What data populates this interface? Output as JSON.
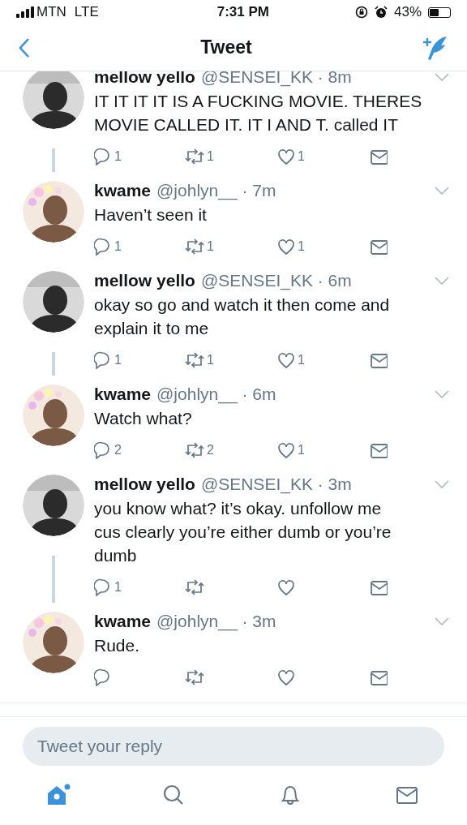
{
  "status_bar": {
    "carrier": "MTN",
    "network": "LTE",
    "time": "7:31 PM",
    "battery": "43%"
  },
  "nav": {
    "title": "Tweet"
  },
  "tweets": [
    {
      "name": "mellow yello",
      "meta": "@SENSEI_KK · 8m",
      "text": "IT IT IT IT IS A FUCKING MOVIE. THERES MOVIE CALLED IT. IT I AND T. called IT",
      "replies": "1",
      "retweets": "1",
      "likes": "1"
    },
    {
      "name": "kwame",
      "meta": "@johlyn__ · 7m",
      "text": "Haven’t seen it",
      "replies": "1",
      "retweets": "1",
      "likes": "1"
    },
    {
      "name": "mellow yello",
      "meta": "@SENSEI_KK · 6m",
      "text": "okay so go and watch it then come and explain it to me",
      "replies": "1",
      "retweets": "1",
      "likes": "1"
    },
    {
      "name": "kwame",
      "meta": "@johlyn__ · 6m",
      "text": "Watch what?",
      "replies": "2",
      "retweets": "2",
      "likes": "1"
    },
    {
      "name": "mellow yello",
      "meta": "@SENSEI_KK · 3m",
      "text": "you know what? it’s okay. unfollow me\ncus clearly you’re either dumb or you’re dumb",
      "replies": "1"
    },
    {
      "name": "kwame",
      "meta": "@johlyn__ · 3m",
      "text": "Rude."
    }
  ],
  "reply_field": {
    "placeholder": "Tweet your reply"
  },
  "tab_bar": [
    {
      "kind": "home",
      "selected": true,
      "badge": true
    },
    {
      "kind": "search",
      "selected": false
    },
    {
      "kind": "notifications",
      "selected": false
    },
    {
      "kind": "messages",
      "selected": false
    }
  ]
}
